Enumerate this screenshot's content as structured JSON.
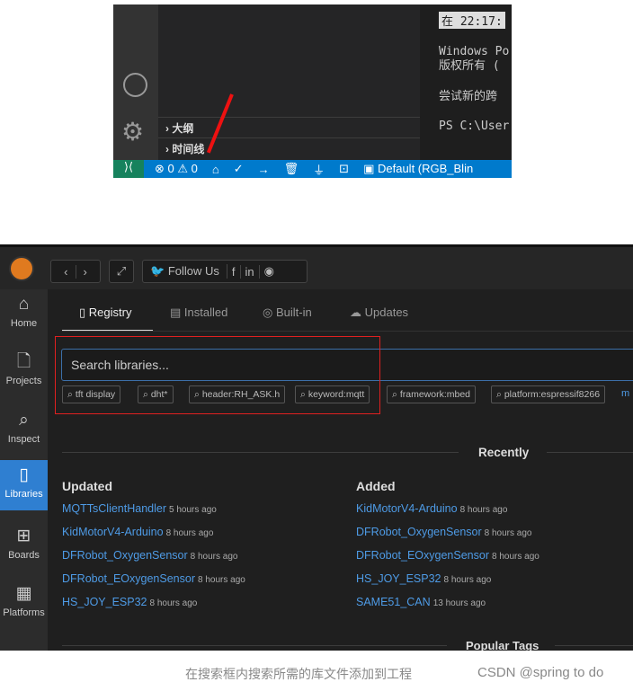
{
  "vscode": {
    "activity": [
      {
        "icon": "account-icon"
      },
      {
        "icon": "gear-icon"
      }
    ],
    "sections": [
      "大纲",
      "时间线"
    ],
    "terminal": {
      "lines": [
        "在 22:17:",
        "Windows Po",
        "版权所有 (",
        "尝试新的跨",
        "PS C:\\User"
      ]
    },
    "status": {
      "errors": "0",
      "warnings": "0",
      "env": "Default (RGB_Blin"
    },
    "status_icons": [
      "remote-icon",
      "home-icon",
      "check-icon",
      "arrow-right-icon",
      "trash-icon",
      "plug-icon",
      "terminal-icon"
    ]
  },
  "pio": {
    "follow_label": "Follow Us",
    "nav": [
      {
        "label": "Home",
        "icon": "⌂"
      },
      {
        "label": "Projects",
        "icon": "🗋"
      },
      {
        "label": "Inspect",
        "icon": "⌕"
      },
      {
        "label": "Libraries",
        "icon": "▯"
      },
      {
        "label": "Boards",
        "icon": "⊞"
      },
      {
        "label": "Platforms",
        "icon": "▦"
      }
    ],
    "tabs": [
      "Registry",
      "Installed",
      "Built-in",
      "Updates"
    ],
    "active_tab": "Registry",
    "search_placeholder": "Search libraries...",
    "chips": [
      "tft display",
      "dht*",
      "header:RH_ASK.h",
      "keyword:mqtt",
      "framework:mbed",
      "platform:espressif8266"
    ],
    "more": "m",
    "recently": "Recently",
    "updated_title": "Updated",
    "added_title": "Added",
    "updated": [
      {
        "name": "MQTTsClientHandler",
        "time": "5 hours ago"
      },
      {
        "name": "KidMotorV4-Arduino",
        "time": "8 hours ago"
      },
      {
        "name": "DFRobot_OxygenSensor",
        "time": "8 hours ago"
      },
      {
        "name": "DFRobot_EOxygenSensor",
        "time": "8 hours ago"
      },
      {
        "name": "HS_JOY_ESP32",
        "time": "8 hours ago"
      }
    ],
    "added": [
      {
        "name": "KidMotorV4-Arduino",
        "time": "8 hours ago"
      },
      {
        "name": "DFRobot_OxygenSensor",
        "time": "8 hours ago"
      },
      {
        "name": "DFRobot_EOxygenSensor",
        "time": "8 hours ago"
      },
      {
        "name": "HS_JOY_ESP32",
        "time": "8 hours ago"
      },
      {
        "name": "SAME51_CAN",
        "time": "13 hours ago"
      }
    ],
    "popular_tags": "Popular Tags",
    "accent": "#2f7fd1"
  },
  "caption": "在搜索框内搜索所需的库文件添加到工程",
  "watermark": "CSDN @spring to do"
}
